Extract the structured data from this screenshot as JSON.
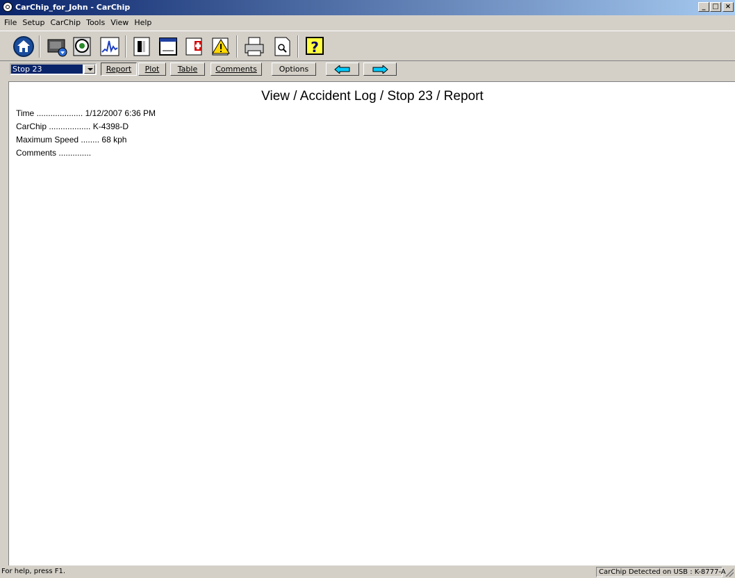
{
  "window": {
    "title": "CarChip_for_John - CarChip"
  },
  "caption_buttons": {
    "minimize": "_",
    "maximize": "□",
    "close": "×"
  },
  "menu": [
    "File",
    "Setup",
    "CarChip",
    "Tools",
    "View",
    "Help"
  ],
  "toolbar_icons": [
    "home-icon",
    "download-chip-icon",
    "view-data-icon",
    "plot-icon",
    "trip-log-icon",
    "window-icon",
    "add-record-icon",
    "alert-icon",
    "print-icon",
    "print-preview-icon",
    "help-icon"
  ],
  "navbar": {
    "selected_stop": "Stop 23",
    "report_label": "Report",
    "plot_label": "Plot",
    "table_label": "Table",
    "comments_label": "Comments",
    "options_label": "Options"
  },
  "report": {
    "heading": "View / Accident Log / Stop 23 / Report",
    "rows": [
      {
        "label": "Time",
        "dots": "....................",
        "value": "1/12/2007 6:36 PM"
      },
      {
        "label": "CarChip",
        "dots": "..................",
        "value": "K-4398-D"
      },
      {
        "label": "Maximum Speed",
        "dots": "........",
        "value": "68 kph"
      },
      {
        "label": "Comments",
        "dots": "..............",
        "value": ""
      }
    ]
  },
  "status": {
    "help_text": "For help, press F1.",
    "device_text": "CarChip Detected on USB : K-8777-A"
  },
  "colors": {
    "titlebar_start": "#0a246a",
    "titlebar_end": "#a6caf0",
    "arrow_fill": "#00ccff"
  }
}
